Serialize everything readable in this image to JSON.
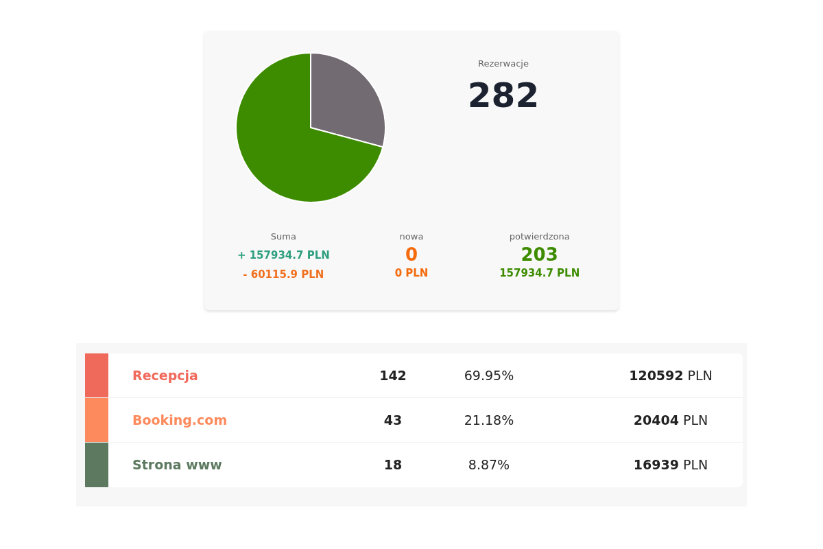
{
  "summary": {
    "title": "Rezerwacje",
    "total": "282",
    "stats": [
      {
        "kind": "sum",
        "label": "Suma",
        "lines": [
          {
            "text": "+ 157934.7 PLN",
            "color": "#2e9e7e"
          },
          {
            "text": "- 60115.9 PLN",
            "color": "#f0701f"
          }
        ]
      },
      {
        "kind": "status",
        "label": "nowa",
        "count": "0",
        "amount": "0 PLN",
        "color": "#f46a0c"
      },
      {
        "kind": "status",
        "label": "potwierdzona",
        "count": "203",
        "amount": "157934.7 PLN",
        "color": "#3d8c00"
      }
    ]
  },
  "sources": [
    {
      "name": "Recepcja",
      "count": "142",
      "share": "69.95%",
      "amount": "**120592** PLN",
      "color": "#f06a5c"
    },
    {
      "name": "Booking.com",
      "count": "43",
      "share": "21.18%",
      "amount": "**20404** PLN",
      "color": "#fd8a5c"
    },
    {
      "name": "Strona www",
      "count": "18",
      "share": "8.87%",
      "amount": "**16939** PLN",
      "color": "#5d7a60"
    }
  ]
}
